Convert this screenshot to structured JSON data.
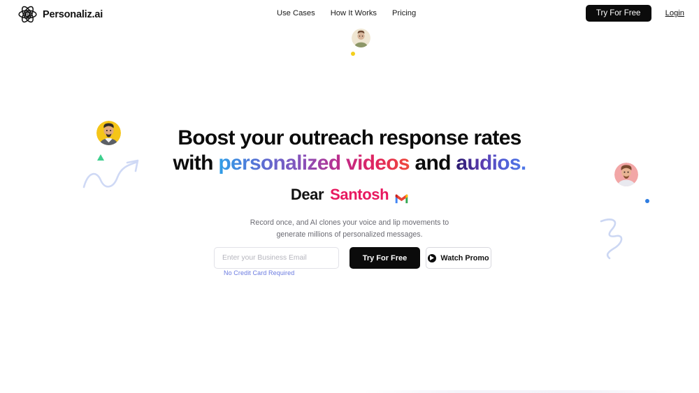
{
  "brand": {
    "name": "Personaliz.ai",
    "logo_icon": "atom-p-icon"
  },
  "nav": {
    "items": [
      {
        "label": "Use Cases"
      },
      {
        "label": "How It Works"
      },
      {
        "label": "Pricing"
      }
    ],
    "cta_label": "Try For Free",
    "login_label": "Login"
  },
  "hero": {
    "headline_line1": "Boost your outreach response rates",
    "headline_line2_prefix": "with ",
    "headline_line2_grad1": "personalized videos",
    "headline_line2_mid": " and ",
    "headline_line2_grad2": "audios.",
    "greeting_prefix": "Dear",
    "greeting_name": "Santosh",
    "greeting_icon": "gmail-icon",
    "subtitle_line1": "Record once, and AI clones your voice and lip movements to",
    "subtitle_line2": "generate millions of personalized messages.",
    "email_placeholder": "Enter your Business Email",
    "email_value": "",
    "cta_label": "Try For Free",
    "watch_label": "Watch Promo",
    "watch_icon": "play-icon",
    "no_credit_card": "No Credit Card Required"
  },
  "decor": {
    "avatar_top": "avatar-beige",
    "avatar_left": "avatar-yellow",
    "avatar_right": "avatar-pink",
    "dot_yellow": "yellow-dot",
    "dot_blue": "blue-dot",
    "triangle_green": "green-triangle",
    "squiggle_left": "wave-arrow-squiggle",
    "squiggle_right": "zigzag-squiggle"
  },
  "colors": {
    "accent_pink": "#e8185f",
    "dark": "#0b0b0b",
    "muted": "#6b6b73",
    "link_blue": "#6a7ae0",
    "yellow": "#f5c518",
    "blue_dot": "#2f7de1",
    "green": "#3ecf8e"
  }
}
